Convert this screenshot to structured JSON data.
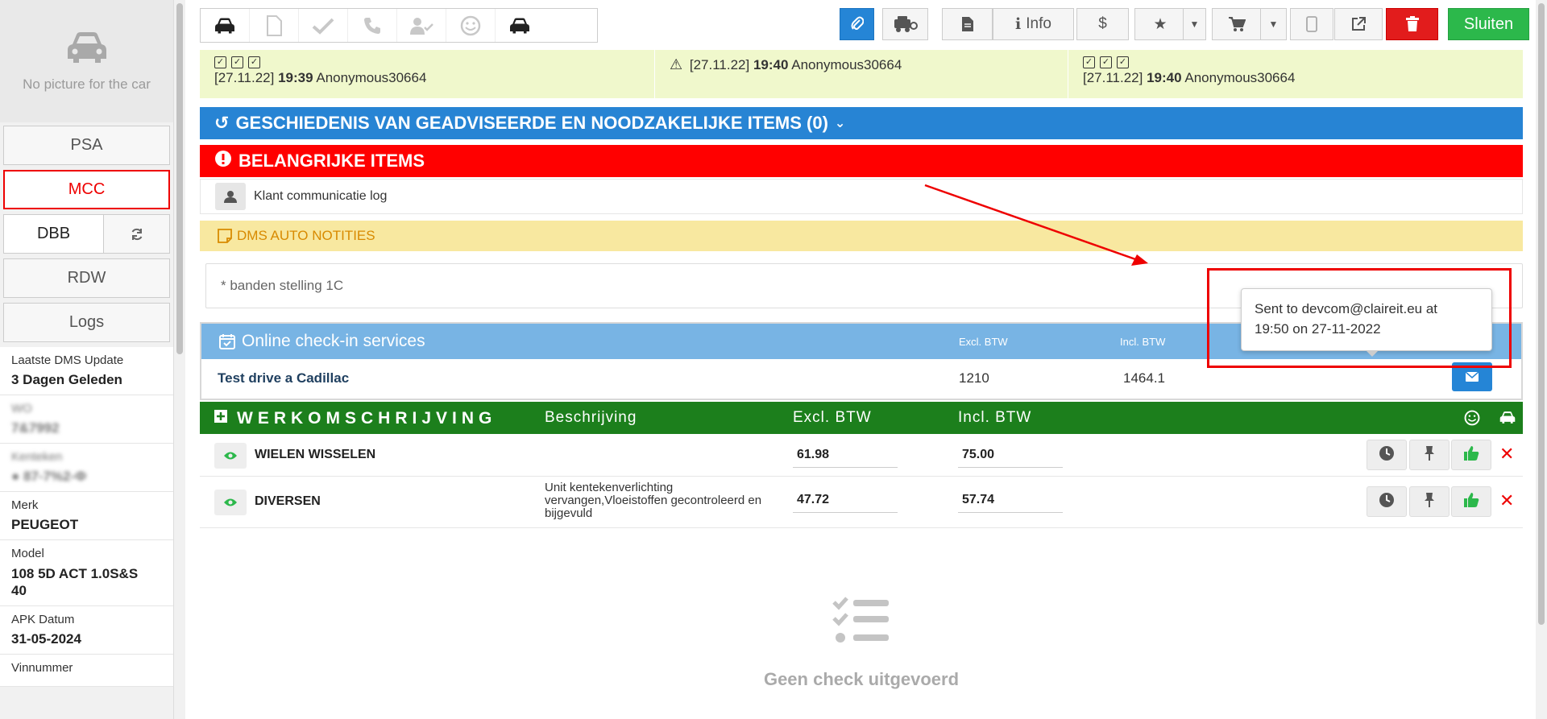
{
  "sidebar": {
    "car_photo_text": "No picture for the car",
    "buttons": {
      "psa": "PSA",
      "mcc": "MCC",
      "dbb": "DBB",
      "rdw": "RDW",
      "logs": "Logs"
    },
    "info": [
      {
        "label": "Laatste DMS Update",
        "value": "3 Dagen Geleden"
      },
      {
        "label": "WO",
        "value": "7&7992"
      },
      {
        "label": "Kenteken",
        "value": "● 87-7%2-Φ"
      },
      {
        "label": "Merk",
        "value": "PEUGEOT"
      },
      {
        "label": "Model",
        "value": "108 5D ACT 1.0S&S 40"
      },
      {
        "label": "APK Datum",
        "value": "31-05-2024"
      },
      {
        "label": "Vinnummer",
        "value": ""
      }
    ]
  },
  "toolbar": {
    "info_label": "Info",
    "close_label": "Sluiten",
    "dollar": "$"
  },
  "log_bar": {
    "entries": [
      {
        "date": "[27.11.22]",
        "time": "19:39",
        "user": "Anonymous30664"
      },
      {
        "date": "[27.11.22]",
        "time": "19:40",
        "user": "Anonymous30664"
      },
      {
        "date": "[27.11.22]",
        "time": "19:40",
        "user": "Anonymous30664"
      }
    ]
  },
  "history_bar": "GESCHIEDENIS VAN GEADVISEERDE EN NOODZAKELIJKE ITEMS (0)",
  "important_bar": "BELANGRIJKE ITEMS",
  "comm_log": "Klant communicatie log",
  "notes": {
    "header": "DMS AUTO NOTITIES",
    "text": "* banden stelling 1C"
  },
  "checkin": {
    "title": "Online check-in services",
    "col_excl": "Excl. BTW",
    "col_incl": "Incl. BTW",
    "row": {
      "name": "Test drive a Cadillac",
      "excl": "1210",
      "incl": "1464.1"
    }
  },
  "tooltip": {
    "line1": "Sent to devcom@claireit.eu at",
    "line2": "19:50 on 27-11-2022"
  },
  "work_order": {
    "title": "WERKOMSCHRIJVING",
    "col_desc": "Beschrijving",
    "col_excl": "Excl. BTW",
    "col_incl": "Incl. BTW",
    "rows": [
      {
        "name": "WIELEN WISSELEN",
        "desc": "",
        "excl": "61.98",
        "incl": "75.00"
      },
      {
        "name": "DIVERSEN",
        "desc": "Unit kentekenverlichting vervangen,Vloeistoffen gecontroleerd en bijgevuld",
        "excl": "47.72",
        "incl": "57.74"
      }
    ]
  },
  "empty_check": "Geen check uitgevoerd",
  "colors": {
    "blue_bar": "#2784d4",
    "red_bar": "#ff0000",
    "green_bar": "#1c7f1c",
    "notes_bar": "#f8e8a0",
    "checkin_head": "#78b4e4",
    "close_button": "#2cb84b",
    "annotation": "#e00000"
  }
}
